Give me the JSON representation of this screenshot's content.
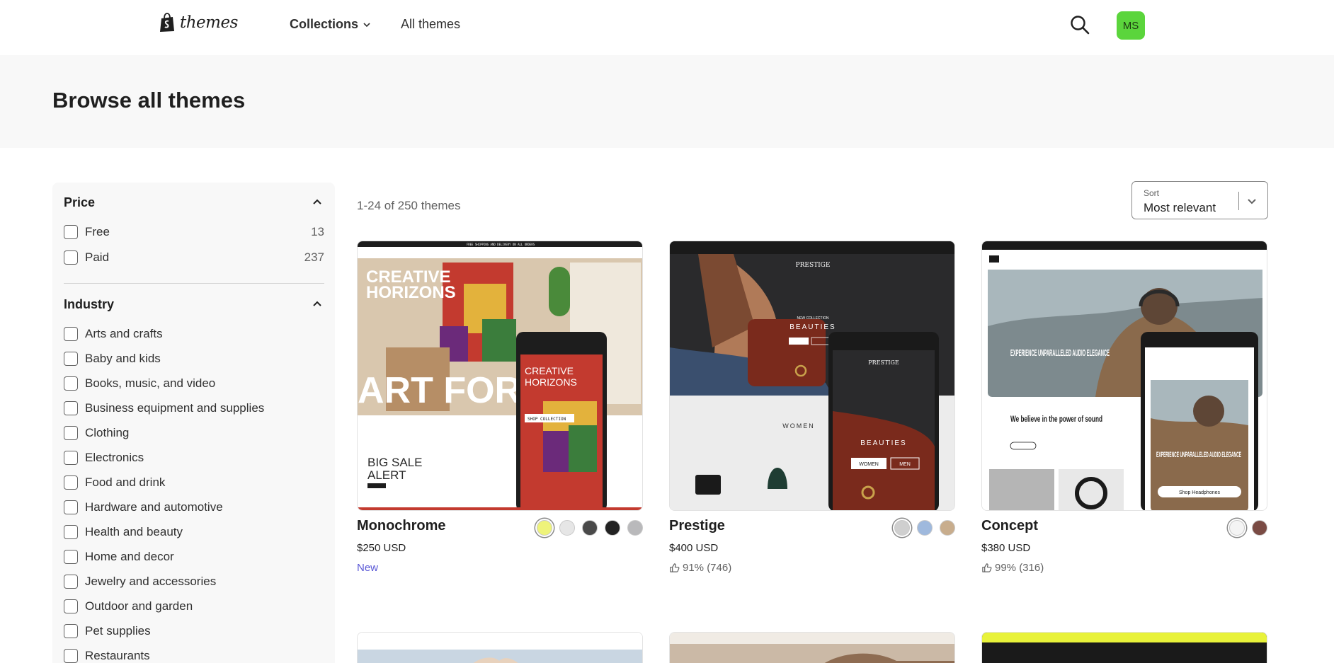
{
  "header": {
    "logo_text": "themes",
    "nav": {
      "collections": "Collections",
      "all_themes": "All themes"
    },
    "avatar_initials": "MS"
  },
  "page": {
    "title": "Browse all themes"
  },
  "filters": {
    "price": {
      "title": "Price",
      "options": [
        {
          "label": "Free",
          "count": "13"
        },
        {
          "label": "Paid",
          "count": "237"
        }
      ]
    },
    "industry": {
      "title": "Industry",
      "options": [
        {
          "label": "Arts and crafts"
        },
        {
          "label": "Baby and kids"
        },
        {
          "label": "Books, music, and video"
        },
        {
          "label": "Business equipment and supplies"
        },
        {
          "label": "Clothing"
        },
        {
          "label": "Electronics"
        },
        {
          "label": "Food and drink"
        },
        {
          "label": "Hardware and automotive"
        },
        {
          "label": "Health and beauty"
        },
        {
          "label": "Home and decor"
        },
        {
          "label": "Jewelry and accessories"
        },
        {
          "label": "Outdoor and garden"
        },
        {
          "label": "Pet supplies"
        },
        {
          "label": "Restaurants"
        }
      ]
    }
  },
  "results": {
    "count_text": "1-24 of 250 themes"
  },
  "sort": {
    "label": "Sort",
    "value": "Most relevant"
  },
  "themes": [
    {
      "name": "Monochrome",
      "price": "$250 USD",
      "extra": "New",
      "swatches": [
        "#eef37a",
        "#e6e6e6",
        "#4a4a4a",
        "#222222",
        "#b9b9bb"
      ],
      "preview": {
        "top_bar": "FREE SHIPPING AND DELIVERY ON ALL ORDERS",
        "headline_1": "CREATIVE",
        "headline_2": "HORIZONS",
        "big_text": "ART FOR T",
        "sale_1": "BIG SALE",
        "sale_2": "ALERT",
        "button": "SHOP COLLECTION"
      }
    },
    {
      "name": "Prestige",
      "price": "$400 USD",
      "extra": "91% (746)",
      "swatches": [
        "#cfcfcf",
        "#9fb9dd",
        "#c8ad8d"
      ],
      "preview": {
        "brand": "PRESTIGE",
        "collection": "NEW COLLECTION",
        "headline": "BEAUTIES",
        "women": "WOMEN",
        "men": "MEN"
      }
    },
    {
      "name": "Concept",
      "price": "$380 USD",
      "extra": "99% (316)",
      "swatches": [
        "#f4f4f4",
        "#7a4b44"
      ],
      "preview": {
        "headline": "EXPERIENCE UNPARALLELED AUDIO ELEGANCE",
        "sub": "We believe in the power of sound",
        "button": "Shop Headphones"
      }
    }
  ],
  "colors": {
    "accent_new": "#5a58d6",
    "avatar_bg": "#5bd53c",
    "band_bg": "#f8f8f8"
  }
}
